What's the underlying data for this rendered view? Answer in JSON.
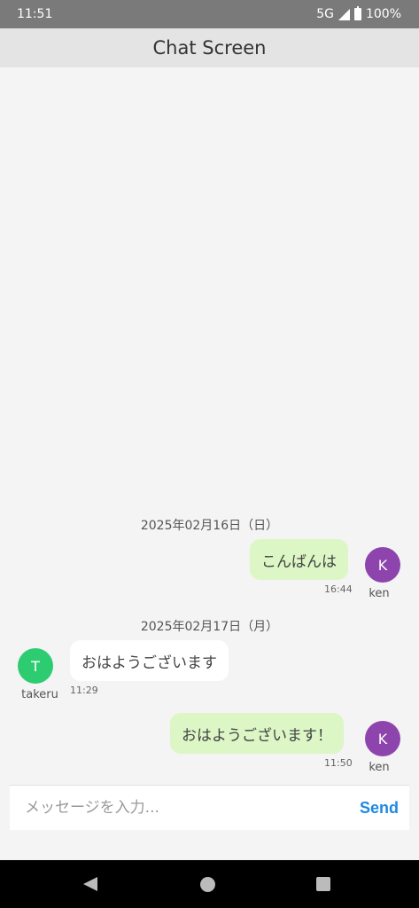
{
  "status_bar": {
    "time": "11:51",
    "network": "5G",
    "battery": "100%",
    "icons": [
      "signal-icon",
      "battery-icon"
    ]
  },
  "header": {
    "title": "Chat Screen"
  },
  "messages": {
    "dates": [
      "2025年02月16日（日）",
      "2025年02月17日（月）"
    ],
    "items": [
      {
        "text": "こんばんは",
        "time": "16:44",
        "sender": "ken",
        "avatar_initial": "K",
        "mine": true
      },
      {
        "text": "おはようございます",
        "time": "11:29",
        "sender": "takeru",
        "avatar_initial": "T",
        "mine": false
      },
      {
        "text": "おはようございます！",
        "time": "11:50",
        "sender": "ken",
        "avatar_initial": "K",
        "mine": true
      }
    ]
  },
  "colors": {
    "mine_bubble": "#dcf6c6",
    "theirs_bubble": "#ffffff",
    "ken_avatar": "#8e44ad",
    "takeru_avatar": "#2ecc71",
    "send_accent": "#1e88e5"
  },
  "composer": {
    "placeholder": "メッセージを入力...",
    "send_label": "Send"
  },
  "nav_bar": {
    "icons": [
      "back-icon",
      "home-icon",
      "recents-icon"
    ]
  }
}
